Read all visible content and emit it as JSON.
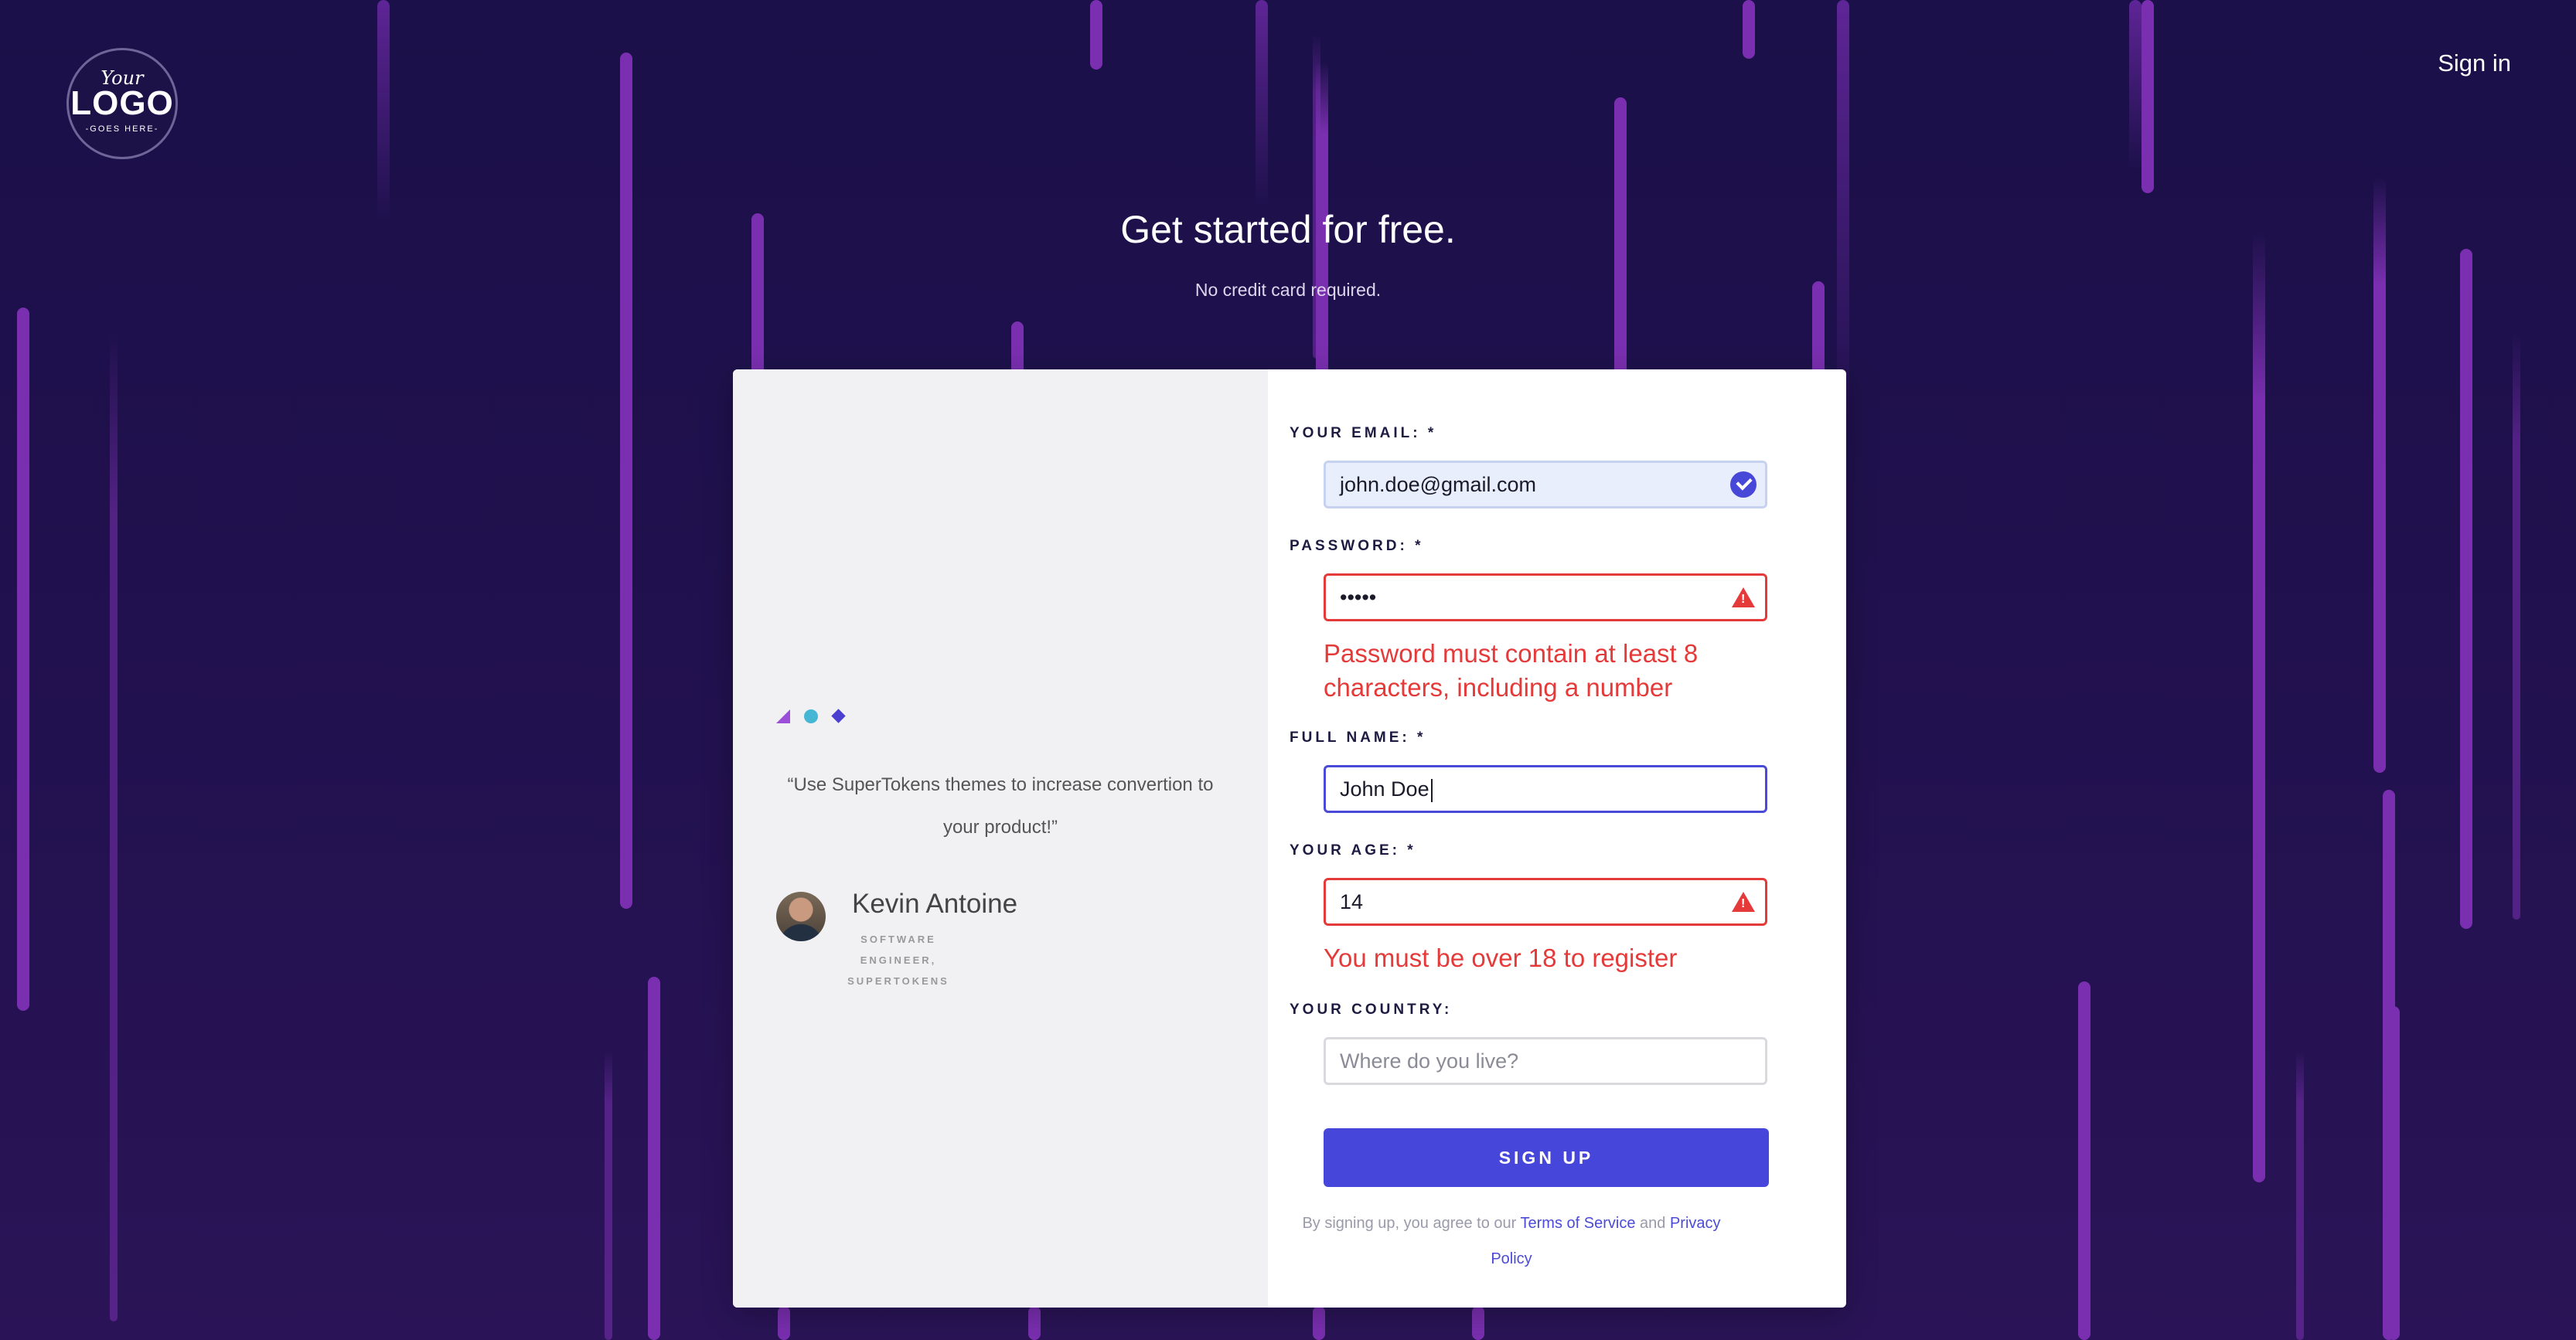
{
  "logo": {
    "top": "Your",
    "main": "LOGO",
    "bottom": "-GOES HERE-"
  },
  "nav": {
    "sign_in": "Sign in"
  },
  "hero": {
    "title": "Get started for free.",
    "subtitle": "No credit card required."
  },
  "testimonial": {
    "quote": "“Use SuperTokens themes to increase convertion to your product!”",
    "name": "Kevin Antoine",
    "role": "SOFTWARE ENGINEER, SUPERTOKENS"
  },
  "form": {
    "email": {
      "label": "YOUR EMAIL: *",
      "value": "john.doe@gmail.com",
      "status": "verified"
    },
    "password": {
      "label": "PASSWORD: *",
      "value": "•••••",
      "error": "Password must contain at least 8 characters, including a number"
    },
    "full_name": {
      "label": "FULL NAME: *",
      "value": "John Doe"
    },
    "age": {
      "label": "YOUR AGE: *",
      "value": "14",
      "error": "You must be over 18 to register"
    },
    "country": {
      "label": "YOUR COUNTRY:",
      "placeholder": "Where do you live?"
    },
    "submit": "SIGN UP",
    "legal_prefix": "By signing up, you agree to our",
    "terms": "Terms of Service",
    "and": "and",
    "privacy": "Privacy Policy"
  },
  "colors": {
    "primary": "#4647da",
    "error": "#e53a3a",
    "background": "#1b1049",
    "streak": "#7a2fb0"
  },
  "icons": {
    "email_status": "check-circle-icon",
    "error": "warning-triangle-icon"
  }
}
